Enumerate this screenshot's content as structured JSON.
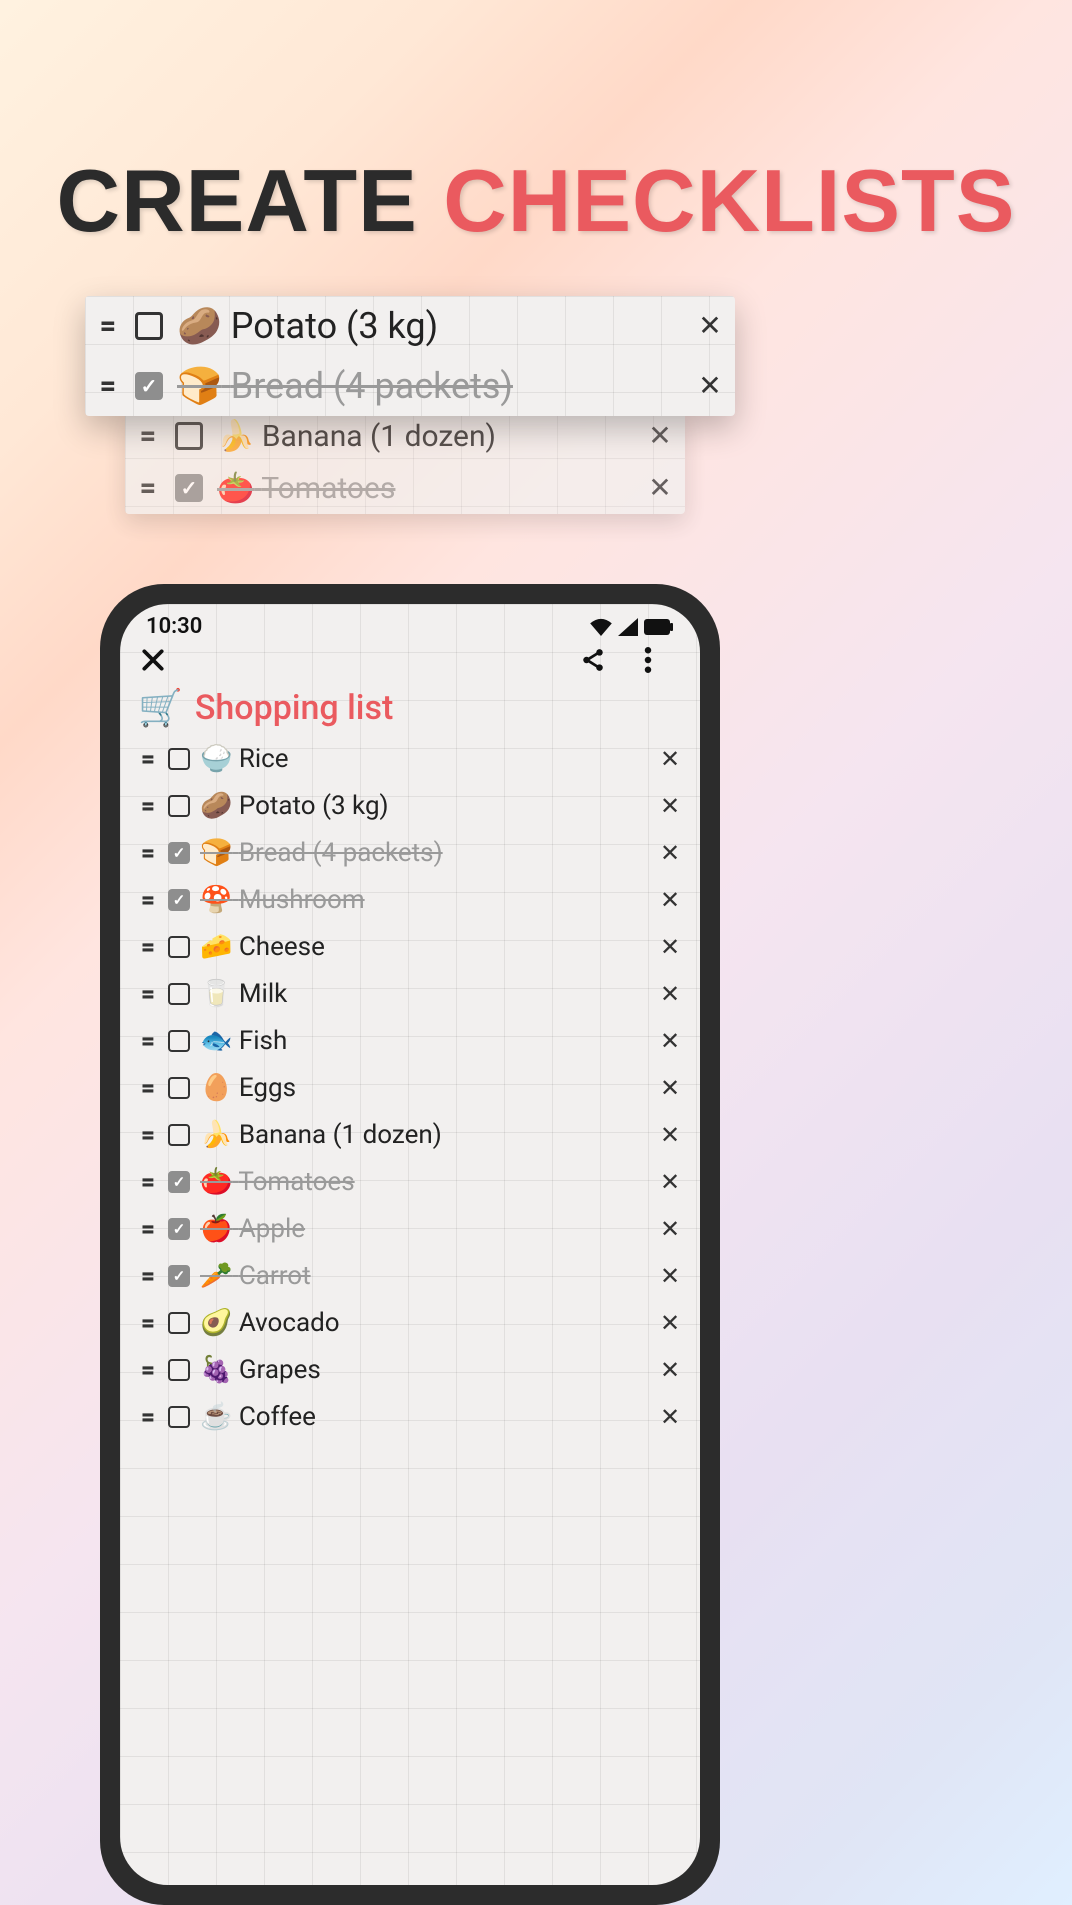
{
  "headline": {
    "part1": "Create",
    "part2": "Checklists"
  },
  "preview_front": [
    {
      "emoji": "🥔",
      "label": "Potato (3 kg)",
      "checked": false
    },
    {
      "emoji": "🍞",
      "label": "Bread (4 packets)",
      "checked": true
    }
  ],
  "preview_back": [
    {
      "emoji": "🍌",
      "label": "Banana (1 dozen)",
      "checked": false
    },
    {
      "emoji": "🍅",
      "label": "Tomatoes",
      "checked": true
    }
  ],
  "phone": {
    "status_time": "10:30",
    "note_title_emoji": "🛒",
    "note_title": "Shopping list",
    "items": [
      {
        "emoji": "🍚",
        "label": "Rice",
        "checked": false
      },
      {
        "emoji": "🥔",
        "label": "Potato (3 kg)",
        "checked": false
      },
      {
        "emoji": "🍞",
        "label": "Bread (4 packets)",
        "checked": true
      },
      {
        "emoji": "🍄",
        "label": "Mushroom",
        "checked": true
      },
      {
        "emoji": "🧀",
        "label": "Cheese",
        "checked": false
      },
      {
        "emoji": "🥛",
        "label": "Milk",
        "checked": false
      },
      {
        "emoji": "🐟",
        "label": "Fish",
        "checked": false
      },
      {
        "emoji": "🥚",
        "label": "Eggs",
        "checked": false
      },
      {
        "emoji": "🍌",
        "label": "Banana (1 dozen)",
        "checked": false
      },
      {
        "emoji": "🍅",
        "label": "Tomatoes",
        "checked": true
      },
      {
        "emoji": "🍎",
        "label": "Apple",
        "checked": true
      },
      {
        "emoji": "🥕",
        "label": "Carrot",
        "checked": true
      },
      {
        "emoji": "🥑",
        "label": "Avocado",
        "checked": false
      },
      {
        "emoji": "🍇",
        "label": "Grapes",
        "checked": false
      },
      {
        "emoji": "☕",
        "label": "Coffee",
        "checked": false
      }
    ]
  }
}
